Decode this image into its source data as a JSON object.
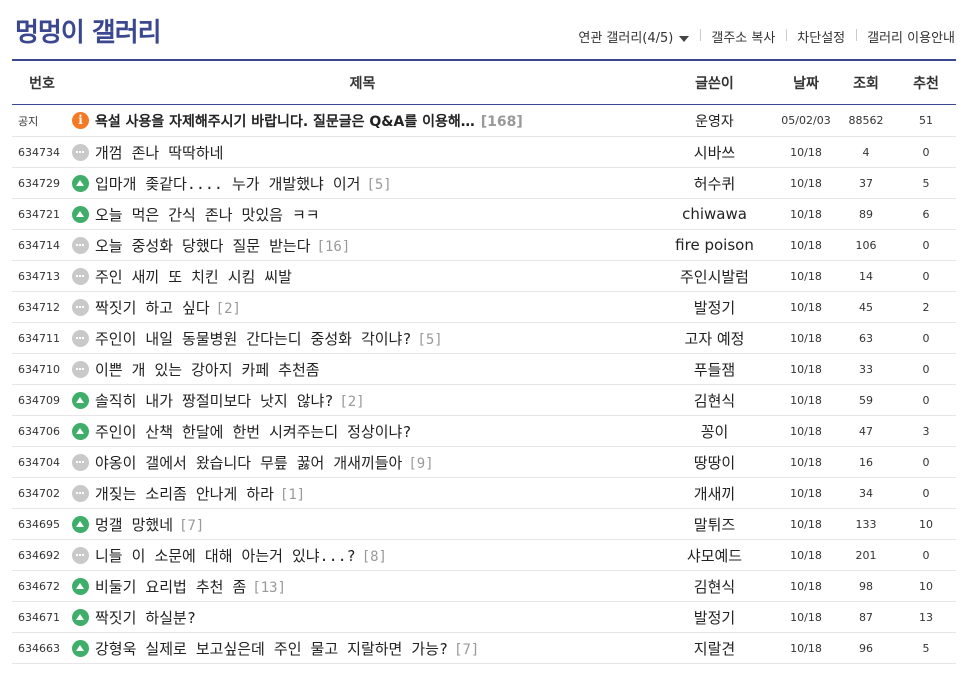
{
  "gallery": {
    "title": "멍멍이 갤러리",
    "links": {
      "related": "연관 갤러리(4/5)",
      "copy": "갤주소 복사",
      "block": "차단설정",
      "guide": "갤러리 이용안내"
    }
  },
  "colors": {
    "accent": "#3b4890",
    "notice_icon": "#f47a24",
    "image_icon": "#3fae6a",
    "text_icon": "#c9c9c9"
  },
  "columns": {
    "num": "번호",
    "subject": "제목",
    "writer": "글쓴이",
    "date": "날짜",
    "views": "조회",
    "recommend": "추천"
  },
  "posts": [
    {
      "num": "공지",
      "type": "notice-icon",
      "subject": "욕설 사용을 자제해주시기 바랍니다. 질문글은 Q&A를 이용해…",
      "reply": "[168]",
      "writer": "운영자",
      "date": "05/02/03",
      "views": "88562",
      "rec": "51"
    },
    {
      "num": "634734",
      "type": "text-icon",
      "subject": "개껌 존나 딱딱하네",
      "reply": "",
      "writer": "시바쓰",
      "date": "10/18",
      "views": "4",
      "rec": "0"
    },
    {
      "num": "634729",
      "type": "image-icon",
      "subject": "입마개 좆같다.... 누가 개발했냐 이거",
      "reply": "[5]",
      "writer": "허수퀴",
      "date": "10/18",
      "views": "37",
      "rec": "5"
    },
    {
      "num": "634721",
      "type": "image-icon",
      "subject": "오늘 먹은 간식 존나 맛있음 ㅋㅋ",
      "reply": "",
      "writer": "chiwawa",
      "date": "10/18",
      "views": "89",
      "rec": "6"
    },
    {
      "num": "634714",
      "type": "text-icon",
      "subject": "오늘 중성화 당했다 질문 받는다",
      "reply": "[16]",
      "writer": "fire poison",
      "date": "10/18",
      "views": "106",
      "rec": "0"
    },
    {
      "num": "634713",
      "type": "text-icon",
      "subject": "주인 새끼 또 치킨 시킴 씨발",
      "reply": "",
      "writer": "주인시발럼",
      "date": "10/18",
      "views": "14",
      "rec": "0"
    },
    {
      "num": "634712",
      "type": "text-icon",
      "subject": "짝짓기 하고 싶다",
      "reply": "[2]",
      "writer": "발정기",
      "date": "10/18",
      "views": "45",
      "rec": "2"
    },
    {
      "num": "634711",
      "type": "text-icon",
      "subject": "주인이 내일 동물병원 간다는디 중성화 각이냐?",
      "reply": "[5]",
      "writer": "고자 예정",
      "date": "10/18",
      "views": "63",
      "rec": "0"
    },
    {
      "num": "634710",
      "type": "text-icon",
      "subject": "이쁜 개 있는 강아지 카페 추천좀",
      "reply": "",
      "writer": "푸들잼",
      "date": "10/18",
      "views": "33",
      "rec": "0"
    },
    {
      "num": "634709",
      "type": "image-icon",
      "subject": "솔직히 내가 짱절미보다 낫지 않냐?",
      "reply": "[2]",
      "writer": "김현식",
      "date": "10/18",
      "views": "59",
      "rec": "0"
    },
    {
      "num": "634706",
      "type": "image-icon",
      "subject": "주인이 산책 한달에 한번 시켜주는디 정상이냐?",
      "reply": "",
      "writer": "꽁이",
      "date": "10/18",
      "views": "47",
      "rec": "3"
    },
    {
      "num": "634704",
      "type": "text-icon",
      "subject": "야옹이 갤에서 왔습니다 무릎 꿇어 개새끼들아",
      "reply": "[9]",
      "writer": "땅땅이",
      "date": "10/18",
      "views": "16",
      "rec": "0"
    },
    {
      "num": "634702",
      "type": "text-icon",
      "subject": "개짖는 소리좀 안나게 하라",
      "reply": "[1]",
      "writer": "개새끼",
      "date": "10/18",
      "views": "34",
      "rec": "0"
    },
    {
      "num": "634695",
      "type": "image-icon",
      "subject": "멍갤 망했네",
      "reply": "[7]",
      "writer": "말튀즈",
      "date": "10/18",
      "views": "133",
      "rec": "10"
    },
    {
      "num": "634692",
      "type": "text-icon",
      "subject": "니들 이 소문에 대해 아는거 있냐...?",
      "reply": "[8]",
      "writer": "샤모예드",
      "date": "10/18",
      "views": "201",
      "rec": "0"
    },
    {
      "num": "634672",
      "type": "image-icon",
      "subject": "비둘기 요리법 추천 좀",
      "reply": "[13]",
      "writer": "김현식",
      "date": "10/18",
      "views": "98",
      "rec": "10"
    },
    {
      "num": "634671",
      "type": "image-icon",
      "subject": "짝짓기 하실분?",
      "reply": "",
      "writer": "발정기",
      "date": "10/18",
      "views": "87",
      "rec": "13"
    },
    {
      "num": "634663",
      "type": "image-icon",
      "subject": "강형욱 실제로 보고싶은데 주인 물고 지랄하면 가능?",
      "reply": "[7]",
      "writer": "지랄견",
      "date": "10/18",
      "views": "96",
      "rec": "5"
    }
  ]
}
